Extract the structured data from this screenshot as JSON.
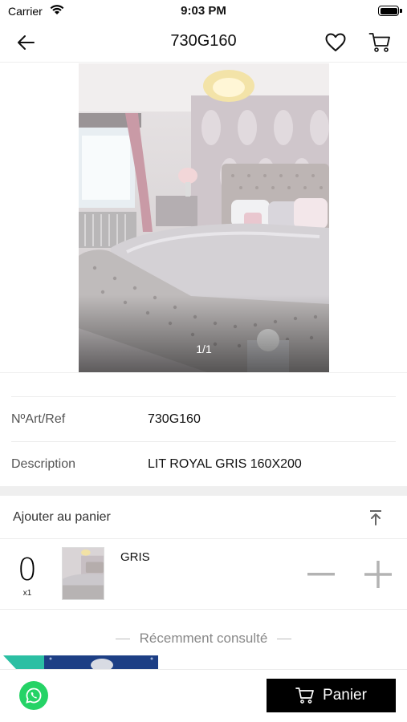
{
  "status_bar": {
    "carrier": "Carrier",
    "time": "9:03 PM"
  },
  "nav": {
    "title": "730G160",
    "back_icon": "arrow-left-icon",
    "favorite_icon": "heart-icon",
    "cart_icon": "cart-icon"
  },
  "product_image": {
    "counter": "1/1"
  },
  "info": {
    "ref_label": "NºArt/Ref",
    "ref_value": "730G160",
    "description_label": "Description",
    "description_value": "LIT ROYAL GRIS 160X200"
  },
  "add_to_cart": {
    "title": "Ajouter au panier",
    "collapse_icon": "collapse-up-icon",
    "quantity": "0",
    "multiplier": "x1",
    "variant_name": "GRIS",
    "minus_icon": "minus-icon",
    "plus_icon": "plus-icon"
  },
  "recent": {
    "title": "Récemment consulté"
  },
  "bottom_bar": {
    "whatsapp_icon": "whatsapp-icon",
    "cart_label": "Panier"
  },
  "colors": {
    "primary": "#000000",
    "whatsapp": "#25d366",
    "divider": "#efefef"
  }
}
